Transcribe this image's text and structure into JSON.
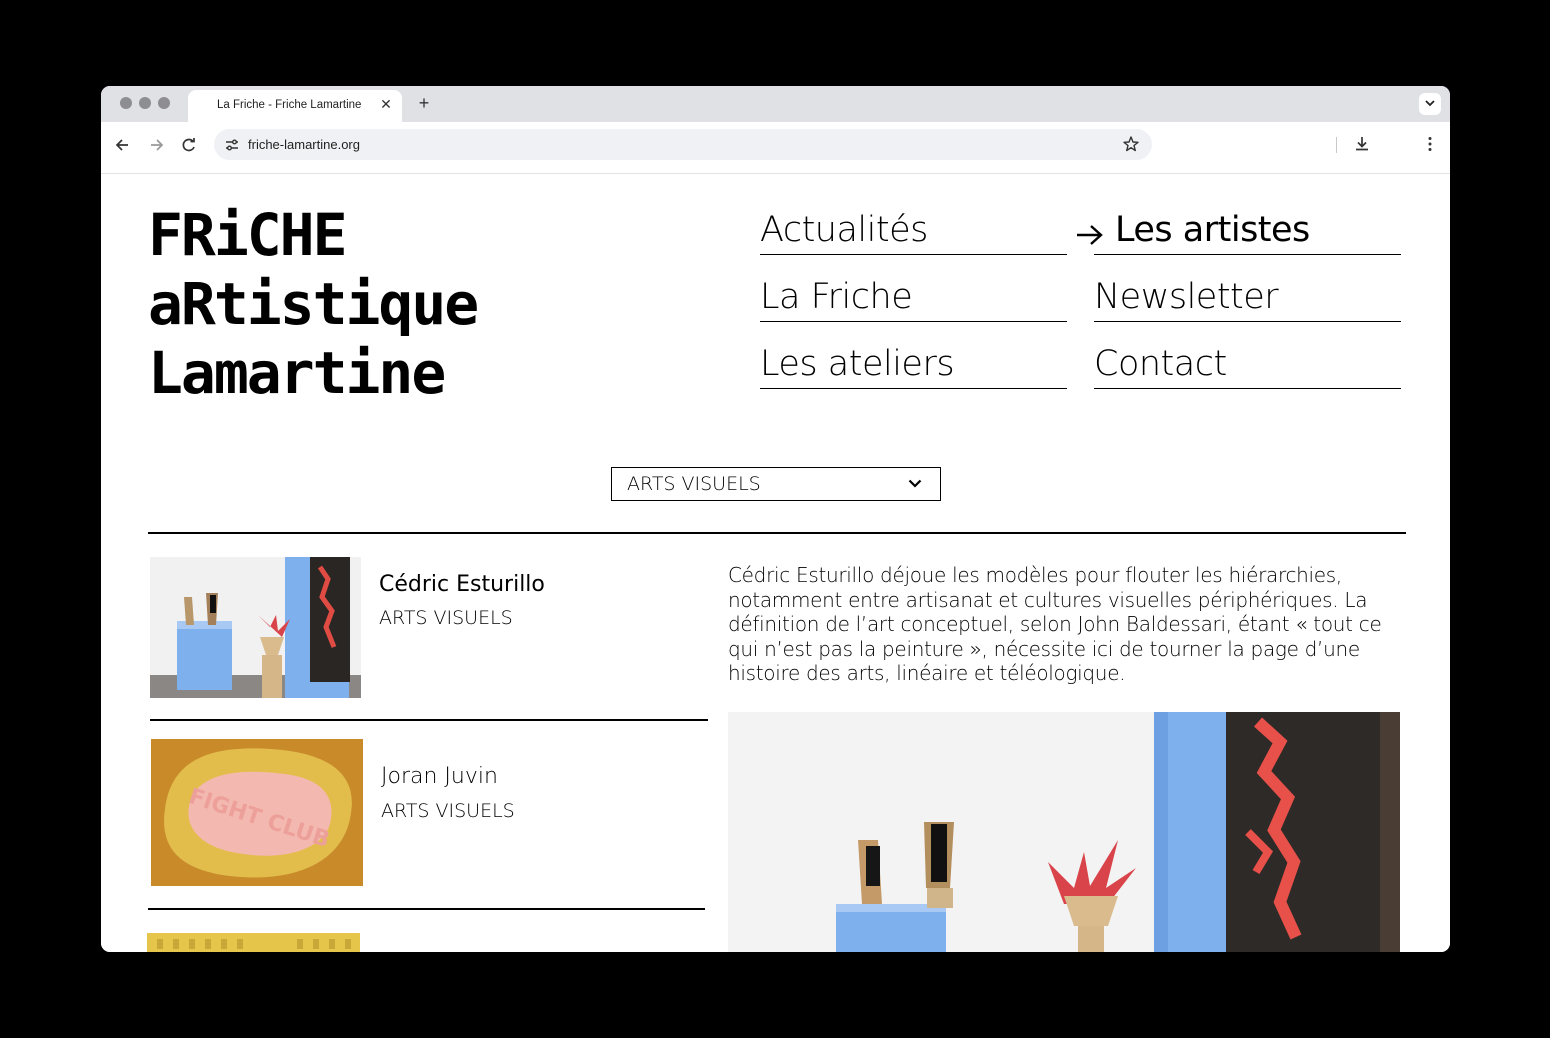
{
  "browser": {
    "tab_title": "La Friche - Friche Lamartine",
    "tab_close": "✕",
    "new_tab": "+",
    "url": "friche-lamartine.org"
  },
  "site": {
    "logo_lines": [
      "FRiCHE",
      "aRtistique",
      "Lamartine"
    ],
    "nav": {
      "actualites": "Actualités",
      "les_artistes": "Les artistes",
      "la_friche": "La Friche",
      "newsletter": "Newsletter",
      "les_ateliers": "Les ateliers",
      "contact": "Contact",
      "active": "Les artistes"
    },
    "filter": {
      "selected": "ARTS VISUELS"
    }
  },
  "artists": [
    {
      "name": "Cédric Esturillo",
      "category": "ARTS VISUELS"
    },
    {
      "name": "Joran Juvin",
      "category": "ARTS VISUELS"
    }
  ],
  "detail": {
    "description": "Cédric Esturillo déjoue les modèles pour flouter les hiérarchies, notamment entre artisanat et cultures visuelles périphériques. La définition de l’art conceptuel, selon John Baldessari, étant « tout ce qui n’est pas la peinture », nécessite ici de tourner la page d’une histoire des arts, linéaire et téléologique."
  },
  "thumb_texts": {
    "soap": "FIGHT CLUB"
  },
  "colors": {
    "accent_blue": "#7fb0ee",
    "soap_bg": "#c98a2a",
    "soap_pink": "#f3b9b0",
    "thumb_yellow": "#e6c64a"
  }
}
